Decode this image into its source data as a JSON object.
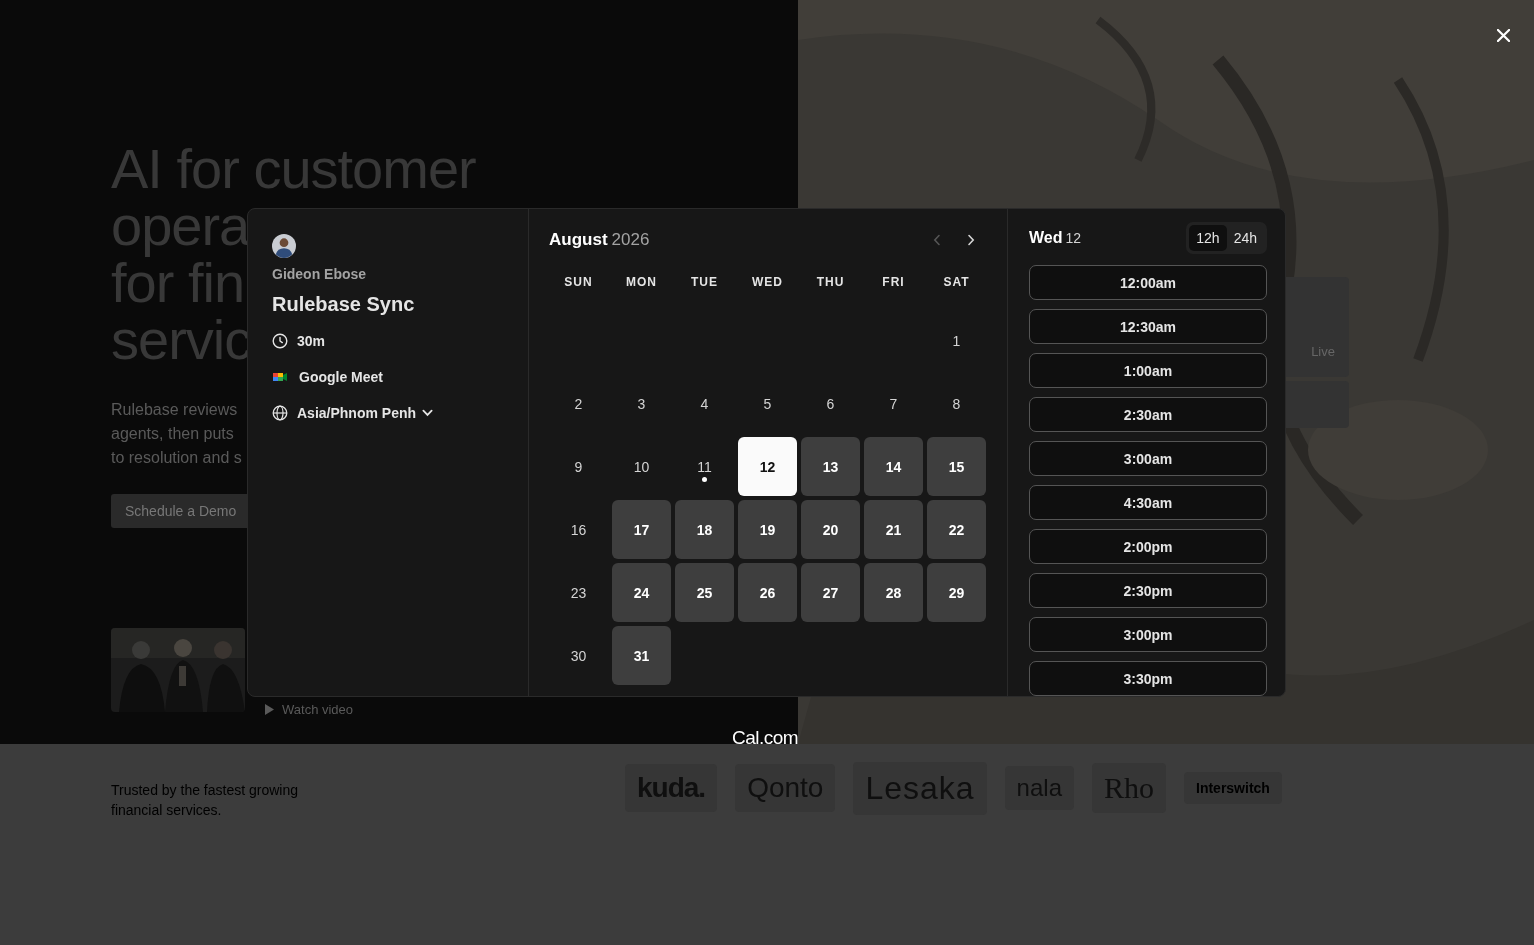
{
  "page": {
    "headline_lines": [
      "AI for customer",
      "opera",
      "for fin",
      "servic"
    ],
    "intro_lines": [
      "Rulebase reviews",
      "agents, then puts",
      "to resolution and s"
    ],
    "cta": "Schedule a Demo",
    "video_link": "Watch video",
    "side_card_label": "Live",
    "trusted": "Trusted by the fastest growing financial services.",
    "logos": [
      {
        "kind": "kuda",
        "text": "kuda."
      },
      {
        "kind": "qonto",
        "text": "Qonto"
      },
      {
        "kind": "lesaka",
        "text": "Lesaka"
      },
      {
        "kind": "nala",
        "text": "nala"
      },
      {
        "kind": "rho",
        "text": "Rho"
      },
      {
        "kind": "interswitch",
        "text": "Interswitch"
      }
    ]
  },
  "booking": {
    "host": "Gideon Ebose",
    "title": "Rulebase Sync",
    "details": [
      {
        "kind": "duration",
        "text": "30m"
      },
      {
        "kind": "video",
        "text": "Google Meet"
      },
      {
        "kind": "timezone",
        "text": "Asia/Phnom Penh"
      }
    ],
    "month": "August",
    "year": "2026",
    "prev_disabled": true,
    "weekdays": [
      "SUN",
      "MON",
      "TUE",
      "WED",
      "THU",
      "FRI",
      "SAT"
    ],
    "weeks": [
      {
        "days": [
          {
            "day": "1",
            "available": false,
            "selected": false,
            "today": false
          }
        ]
      },
      {
        "days": [
          {
            "day": "2",
            "available": false,
            "selected": false,
            "today": false
          },
          {
            "day": "3",
            "available": false,
            "selected": false,
            "today": false
          },
          {
            "day": "4",
            "available": false,
            "selected": false,
            "today": false
          },
          {
            "day": "5",
            "available": false,
            "selected": false,
            "today": false
          },
          {
            "day": "6",
            "available": false,
            "selected": false,
            "today": false
          },
          {
            "day": "7",
            "available": false,
            "selected": false,
            "today": false
          },
          {
            "day": "8",
            "available": false,
            "selected": false,
            "today": false
          }
        ]
      },
      {
        "days": [
          {
            "day": "9",
            "available": false,
            "selected": false,
            "today": false
          },
          {
            "day": "10",
            "available": false,
            "selected": false,
            "today": false
          },
          {
            "day": "11",
            "available": false,
            "selected": false,
            "today": true
          },
          {
            "day": "12",
            "available": true,
            "selected": true,
            "today": false
          },
          {
            "day": "13",
            "available": true,
            "selected": false,
            "today": false
          },
          {
            "day": "14",
            "available": true,
            "selected": false,
            "today": false
          },
          {
            "day": "15",
            "available": true,
            "selected": false,
            "today": false
          }
        ]
      },
      {
        "days": [
          {
            "day": "16",
            "available": false,
            "selected": false,
            "today": false
          },
          {
            "day": "17",
            "available": true,
            "selected": false,
            "today": false
          },
          {
            "day": "18",
            "available": true,
            "selected": false,
            "today": false
          },
          {
            "day": "19",
            "available": true,
            "selected": false,
            "today": false
          },
          {
            "day": "20",
            "available": true,
            "selected": false,
            "today": false
          },
          {
            "day": "21",
            "available": true,
            "selected": false,
            "today": false
          },
          {
            "day": "22",
            "available": true,
            "selected": false,
            "today": false
          }
        ]
      },
      {
        "days": [
          {
            "day": "23",
            "available": false,
            "selected": false,
            "today": false
          },
          {
            "day": "24",
            "available": true,
            "selected": false,
            "today": false
          },
          {
            "day": "25",
            "available": true,
            "selected": false,
            "today": false
          },
          {
            "day": "26",
            "available": true,
            "selected": false,
            "today": false
          },
          {
            "day": "27",
            "available": true,
            "selected": false,
            "today": false
          },
          {
            "day": "28",
            "available": true,
            "selected": false,
            "today": false
          },
          {
            "day": "29",
            "available": true,
            "selected": false,
            "today": false
          }
        ]
      },
      {
        "days": [
          {
            "day": "30",
            "available": false,
            "selected": false,
            "today": false
          },
          {
            "day": "31",
            "available": true,
            "selected": false,
            "today": false
          }
        ]
      }
    ],
    "slots_day": "Wed",
    "slots_date": "12",
    "formats": [
      {
        "label": "12h",
        "selected": true
      },
      {
        "label": "24h",
        "selected": false
      }
    ],
    "slots": [
      "12:00am",
      "12:30am",
      "1:00am",
      "2:30am",
      "3:00am",
      "4:30am",
      "2:00pm",
      "2:30pm",
      "3:00pm",
      "3:30pm"
    ]
  },
  "footer_brand": "Cal.com"
}
